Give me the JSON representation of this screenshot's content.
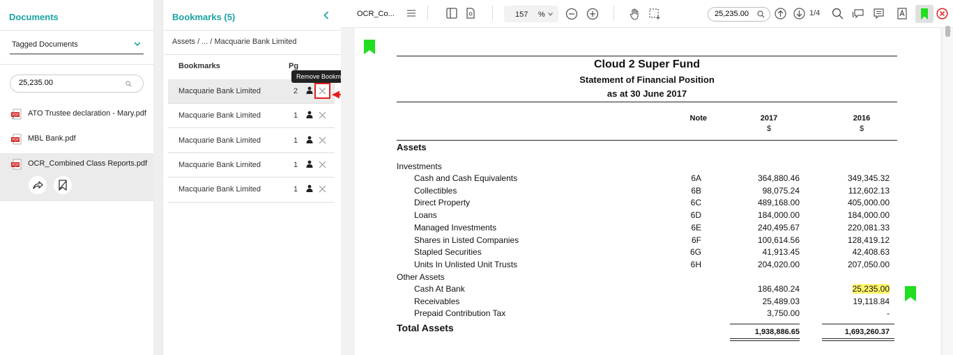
{
  "documents": {
    "title": "Documents",
    "filter_label": "Tagged Documents",
    "search_value": "25,235.00",
    "files": [
      {
        "name": "ATO Trustee declaration - Mary.pdf"
      },
      {
        "name": "MBL Bank.pdf"
      },
      {
        "name": "OCR_Combined Class Reports.pdf"
      }
    ]
  },
  "bookmarks": {
    "title": "Bookmarks (5)",
    "breadcrumb": "Assets / ... / Macquarie Bank Limited",
    "col_bookmarks": "Bookmarks",
    "col_pg": "Pg",
    "tooltip": "Remove Bookmark",
    "rows": [
      {
        "name": "Macquarie Bank Limited",
        "pg": "2"
      },
      {
        "name": "Macquarie Bank Limited",
        "pg": "1"
      },
      {
        "name": "Macquarie Bank Limited",
        "pg": "1"
      },
      {
        "name": "Macquarie Bank Limited",
        "pg": "1"
      },
      {
        "name": "Macquarie Bank Limited",
        "pg": "1"
      }
    ]
  },
  "toolbar": {
    "doc_tab": "OCR_Co...",
    "zoom": "157",
    "zoom_unit": "%",
    "search_value": "25,235.00",
    "page_indicator": "1/4"
  },
  "colors": {
    "accent": "#1aa3a3",
    "bookmark": "#22dd22",
    "highlight": "#fff56b",
    "danger": "#e21d1d"
  },
  "pdf": {
    "title": "Cloud 2 Super Fund",
    "subtitle": "Statement of Financial Position",
    "date": "as at 30 June 2017",
    "col_note": "Note",
    "col_2017": "2017",
    "col_2016": "2016",
    "currency": "$",
    "section": "Assets",
    "group1": "Investments",
    "group2": "Other Assets",
    "investments": [
      {
        "label": "Cash and Cash Equivalents",
        "note": "6A",
        "y2017": "364,880.46",
        "y2016": "349,345.32"
      },
      {
        "label": "Collectibles",
        "note": "6B",
        "y2017": "98,075.24",
        "y2016": "112,602.13"
      },
      {
        "label": "Direct Property",
        "note": "6C",
        "y2017": "489,168.00",
        "y2016": "405,000.00"
      },
      {
        "label": "Loans",
        "note": "6D",
        "y2017": "184,000.00",
        "y2016": "184,000.00"
      },
      {
        "label": "Managed Investments",
        "note": "6E",
        "y2017": "240,495.67",
        "y2016": "220,081.33"
      },
      {
        "label": "Shares in Listed Companies",
        "note": "6F",
        "y2017": "100,614.56",
        "y2016": "128,419.12"
      },
      {
        "label": "Stapled Securities",
        "note": "6G",
        "y2017": "41,913.45",
        "y2016": "42,408.63"
      },
      {
        "label": "Units In Unlisted Unit Trusts",
        "note": "6H",
        "y2017": "204,020.00",
        "y2016": "207,050.00"
      }
    ],
    "other": [
      {
        "label": "Cash At Bank",
        "note": "",
        "y2017": "186,480.24",
        "y2016": "25,235.00"
      },
      {
        "label": "Receivables",
        "note": "",
        "y2017": "25,489.03",
        "y2016": "19,118.84"
      },
      {
        "label": "Prepaid Contribution Tax",
        "note": "",
        "y2017": "3,750.00",
        "y2016": "-"
      }
    ],
    "total_label": "Total Assets",
    "total_2017": "1,938,886.65",
    "total_2016": "1,693,260.37"
  }
}
